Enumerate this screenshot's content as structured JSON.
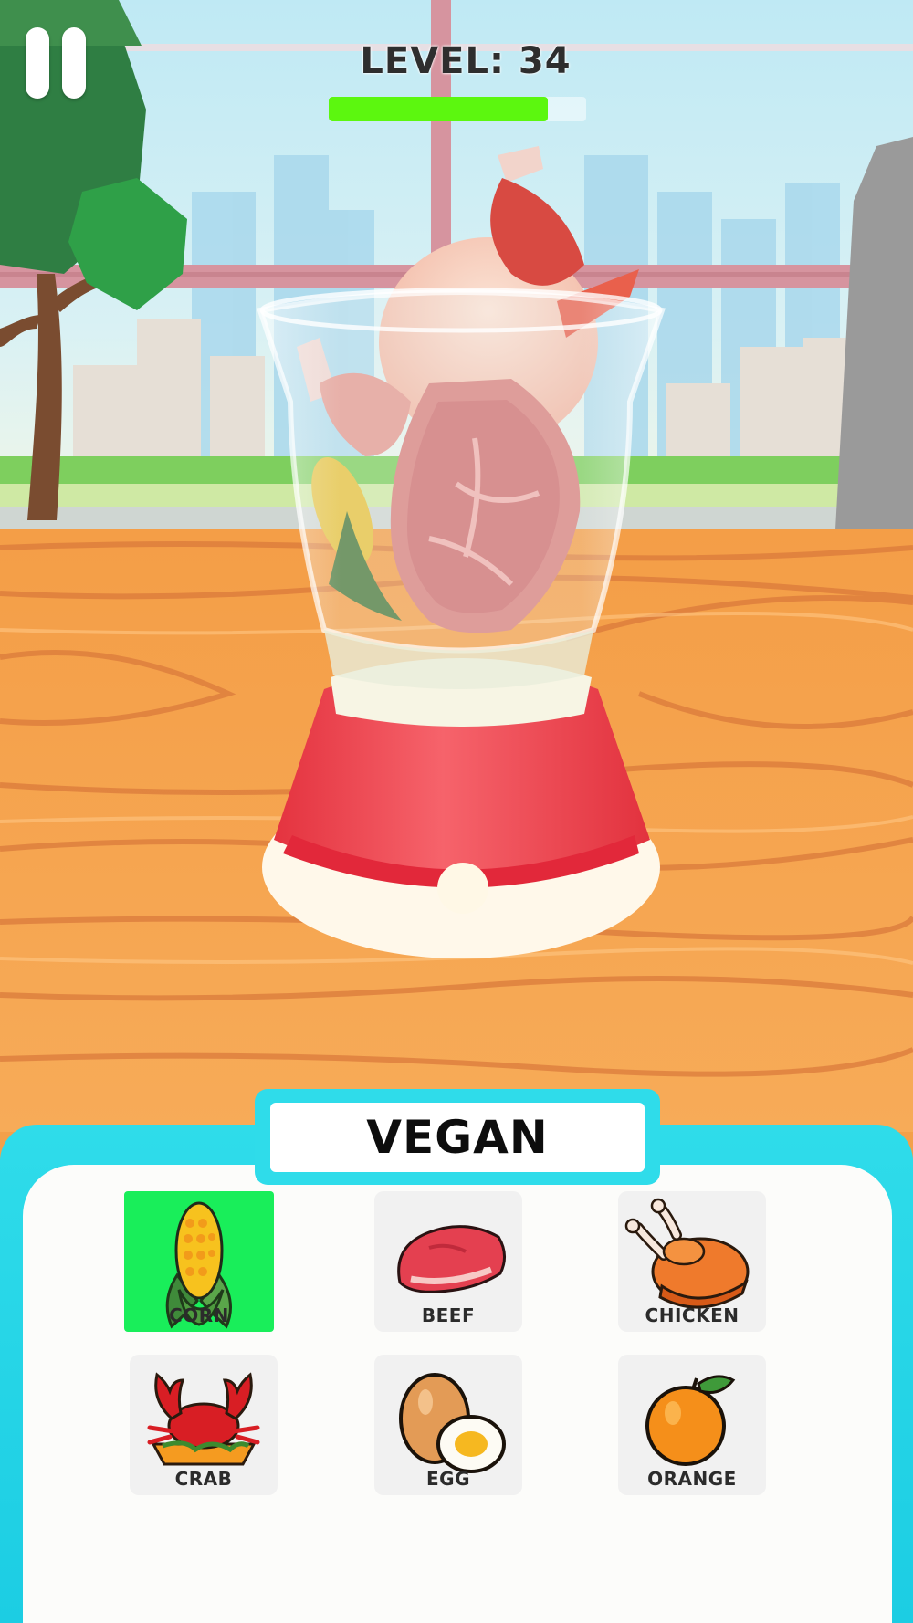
{
  "hud": {
    "level_text": "LEVEL: 34",
    "progress_fraction": 0.85
  },
  "blender": {
    "contents": [
      "chicken-drumstick",
      "whole-chicken",
      "drumstick",
      "corn",
      "beef-steak"
    ],
    "base_color": "#ee3e48"
  },
  "panel": {
    "category": "VEGAN",
    "items": [
      {
        "label": "CORN",
        "icon": "corn-icon",
        "selected": true
      },
      {
        "label": "BEEF",
        "icon": "beef-icon",
        "selected": false
      },
      {
        "label": "CHICKEN",
        "icon": "chicken-icon",
        "selected": false
      },
      {
        "label": "CRAB",
        "icon": "crab-icon",
        "selected": false
      },
      {
        "label": "EGG",
        "icon": "egg-icon",
        "selected": false
      },
      {
        "label": "ORANGE",
        "icon": "orange-icon",
        "selected": false
      }
    ],
    "accent_color": "#2fdcea",
    "selected_color": "#19ee5a"
  }
}
